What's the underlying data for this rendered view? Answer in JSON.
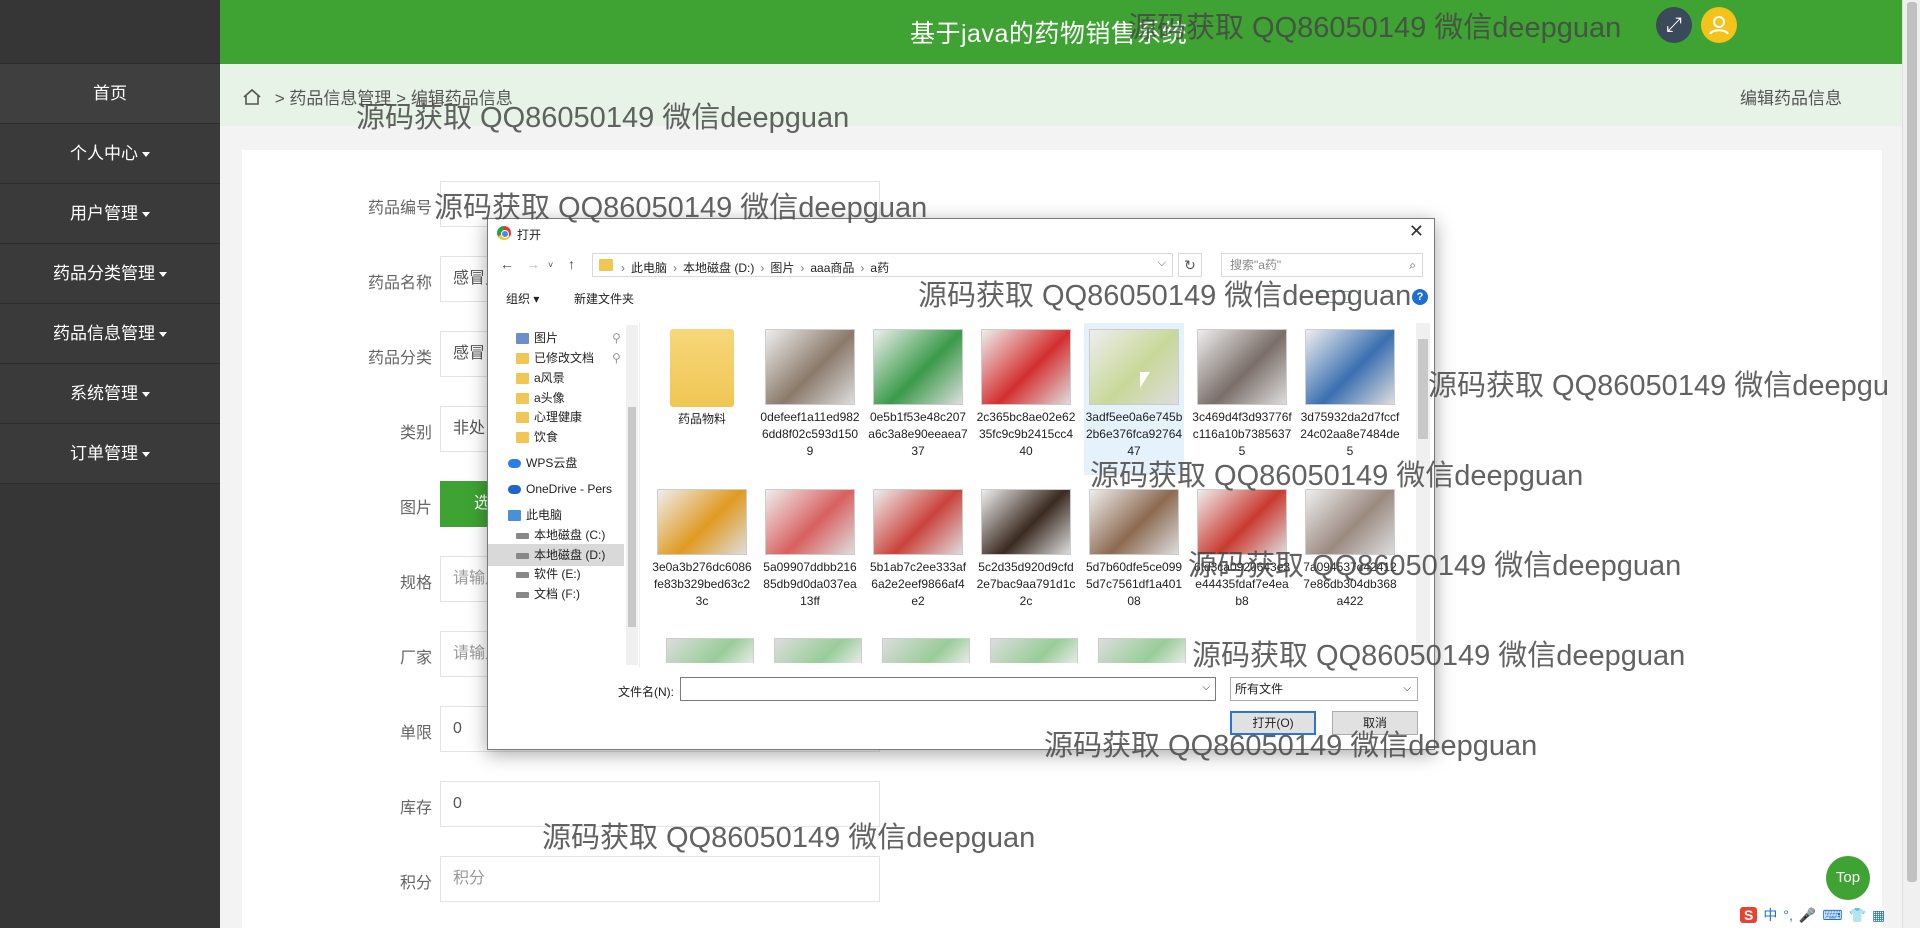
{
  "app": {
    "title": "基于java的药物销售系统",
    "fullscreen_icon": "expand-icon",
    "user_icon": "user-icon"
  },
  "sidebar": {
    "items": [
      {
        "label": "首页",
        "dropdown": false
      },
      {
        "label": "个人中心",
        "dropdown": true
      },
      {
        "label": "用户管理",
        "dropdown": true
      },
      {
        "label": "药品分类管理",
        "dropdown": true
      },
      {
        "label": "药品信息管理",
        "dropdown": true
      },
      {
        "label": "系统管理",
        "dropdown": true
      },
      {
        "label": "订单管理",
        "dropdown": true
      }
    ]
  },
  "breadcrumb": {
    "sep": ">",
    "level1": "药品信息管理",
    "level2": "编辑药品信息",
    "right_title": "编辑药品信息"
  },
  "form": {
    "fields": [
      {
        "label": "药品编号",
        "value": "",
        "placeholder": ""
      },
      {
        "label": "药品名称",
        "value": "感冒灵",
        "placeholder": ""
      },
      {
        "label": "药品分类",
        "value": "感冒",
        "placeholder": ""
      },
      {
        "label": "类别",
        "value": "非处",
        "placeholder": ""
      },
      {
        "label": "图片",
        "button": "选择文件"
      },
      {
        "label": "规格",
        "value": "",
        "placeholder": "请输入"
      },
      {
        "label": "厂家",
        "value": "",
        "placeholder": "请输入"
      },
      {
        "label": "单限",
        "value": "0",
        "placeholder": ""
      },
      {
        "label": "库存",
        "value": "0",
        "placeholder": ""
      },
      {
        "label": "积分",
        "value": "",
        "placeholder": "积分"
      }
    ]
  },
  "top_button": "Top",
  "ime": {
    "logo": "S",
    "mode": "中"
  },
  "dialog": {
    "title": "打开",
    "close": "✕",
    "path": [
      "此电脑",
      "本地磁盘 (D:)",
      "图片",
      "aaa商品",
      "a药"
    ],
    "search_placeholder": "搜索\"a药\"",
    "organize": "组织 ▾",
    "new_folder": "新建文件夹",
    "help": "?",
    "tree": [
      {
        "label": "图片",
        "icon": "pictures-folder-icon",
        "pinned": true
      },
      {
        "label": "已修改文档",
        "icon": "folder-icon",
        "pinned": true
      },
      {
        "label": "a风景",
        "icon": "folder-icon"
      },
      {
        "label": "a头像",
        "icon": "folder-icon"
      },
      {
        "label": "心理健康",
        "icon": "folder-icon"
      },
      {
        "label": "饮食",
        "icon": "folder-icon"
      },
      {
        "label": "WPS云盘",
        "icon": "cloud-icon"
      },
      {
        "label": "OneDrive - Pers",
        "icon": "onedrive-icon"
      },
      {
        "label": "此电脑",
        "icon": "computer-icon"
      },
      {
        "label": "本地磁盘 (C:)",
        "icon": "drive-icon"
      },
      {
        "label": "本地磁盘 (D:)",
        "icon": "drive-icon",
        "selected": true
      },
      {
        "label": "软件 (E:)",
        "icon": "drive-icon"
      },
      {
        "label": "文档 (F:)",
        "icon": "drive-icon"
      }
    ],
    "files": [
      {
        "name": "药品物料",
        "kind": "folder",
        "color": "#f0c654"
      },
      {
        "name": "0defeef1a11ed9826dd8f02c593d1509",
        "kind": "image",
        "color": "#8a7a6a"
      },
      {
        "name": "0e5b1f53e48c207a6c3a8e90eeaea737",
        "kind": "image",
        "color": "#3a9a4a"
      },
      {
        "name": "2c365bc8ae02e6235fc9c9b2415cc440",
        "kind": "image",
        "color": "#d32f2f"
      },
      {
        "name": "3adf5ee0a6e745b2b6e376fca9276447",
        "kind": "image",
        "color": "#c8d89a",
        "hover": true
      },
      {
        "name": "3c469d4f3d93776fc116a10b73856375",
        "kind": "image",
        "color": "#7a6e68"
      },
      {
        "name": "3d75932da2d7fccf24c02aa8e7484de5",
        "kind": "image",
        "color": "#3b6fb0"
      },
      {
        "name": "3e0a3b276dc6086fe83b329bed63c23c",
        "kind": "image",
        "color": "#e09a20"
      },
      {
        "name": "5a09907ddbb21685db9d0da037ea13ff",
        "kind": "image",
        "color": "#d86060"
      },
      {
        "name": "5b1ab7c2ee333af6a2e2eef9866af4e2",
        "kind": "image",
        "color": "#c9433c"
      },
      {
        "name": "5c2d35d920d9cfd2e7bac9aa791d1c2c",
        "kind": "image",
        "color": "#3a2a20"
      },
      {
        "name": "5d7b60dfe5ce0995d7c7561df1a40108",
        "kind": "image",
        "color": "#8c6a50"
      },
      {
        "name": "6fd3ca0920643e3e44435fdaf7e4eab8",
        "kind": "image",
        "color": "#c83a30"
      },
      {
        "name": "7a094537d424127e86db304db368a422",
        "kind": "image",
        "color": "#9a8a80"
      }
    ],
    "filename_label": "文件名(N):",
    "filename_value": "",
    "filetype": "所有文件",
    "open_label": "打开(O)",
    "cancel_label": "取消"
  },
  "watermarks": [
    "源码获取 QQ86050149 微信deepguan",
    "源码获取 QQ86050149 微信deepguan",
    "源码获取 QQ86050149 微信deepguan",
    "源码获取 QQ86050149 微信deepguan",
    "源码获取 QQ86050149 微信deepgu",
    "源码获取 QQ86050149 微信deepguan",
    "源码获取 QQ86050149 微信deepguan",
    "源码获取 QQ86050149 微信deepguan",
    "源码获取 QQ86050149 微信deepguan",
    "源码获取 QQ86050149 微信deepguan"
  ]
}
